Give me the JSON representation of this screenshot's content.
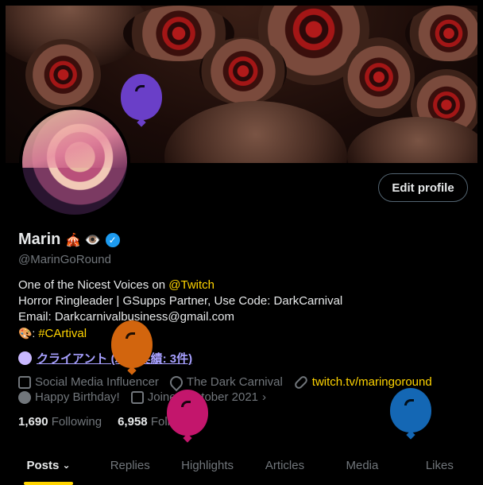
{
  "profile": {
    "display_name": "Marin",
    "name_emojis": "🎪 👁️",
    "handle": "@MarinGoRound",
    "edit_button": "Edit profile"
  },
  "bio": {
    "line1_text": "One of the Nicest Voices on ",
    "line1_link": "@Twitch",
    "line2": "Horror Ringleader | GSupps Partner, Use Code: DarkCarnival",
    "line3": "Email: Darkcarnivalbusiness@gmail.com",
    "line4_prefix": "🎨: ",
    "line4_link": "#CArtival"
  },
  "client_badge": "クライアント (取引実績: 3件)",
  "meta": {
    "category": "Social Media Influencer",
    "location": "The Dark Carnival",
    "website": "twitch.tv/maringoround",
    "birthday": "Happy Birthday!",
    "joined": "Joined October 2021"
  },
  "counts": {
    "following_value": "1,690",
    "following_label": "Following",
    "followers_value": "6,958",
    "followers_label": "Followers"
  },
  "tabs": [
    "Posts",
    "Replies",
    "Highlights",
    "Articles",
    "Media",
    "Likes"
  ],
  "colors": {
    "accent": "#ffd400",
    "verified": "#1d9bf0",
    "balloons": [
      "#6a3fc8",
      "#d2650e",
      "#c3166c",
      "#1467b4"
    ]
  }
}
